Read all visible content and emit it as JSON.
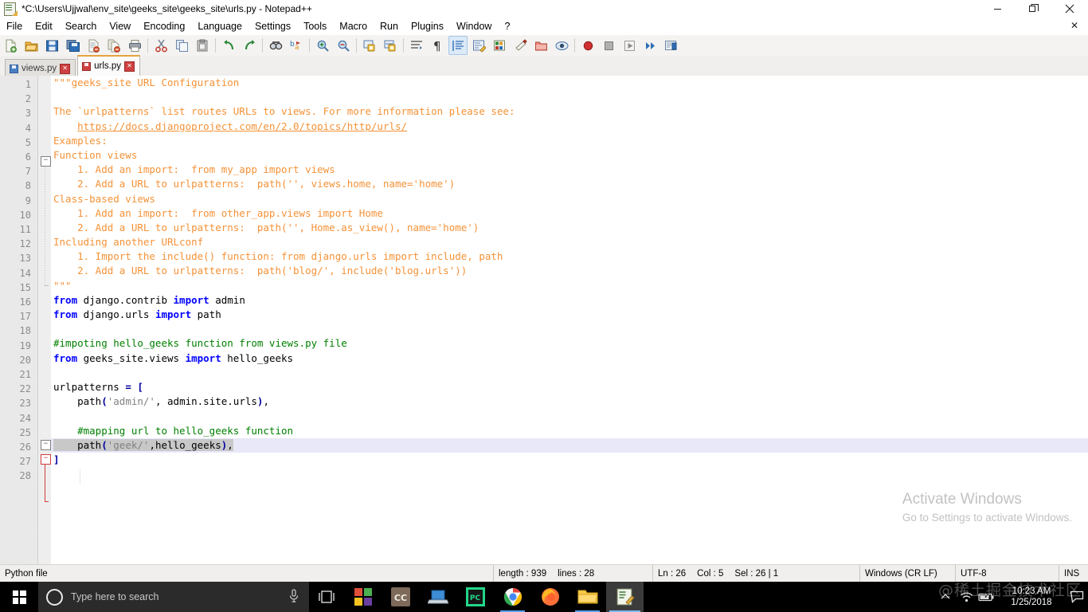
{
  "window": {
    "title": "*C:\\Users\\Ujjwal\\env_site\\geeks_site\\geeks_site\\urls.py - Notepad++",
    "app_icon": "notepad-plus-plus-icon",
    "controls": {
      "minimize": "minimize-icon",
      "restore": "restore-icon",
      "close": "close-icon"
    }
  },
  "menu": {
    "items": [
      "File",
      "Edit",
      "Search",
      "View",
      "Encoding",
      "Language",
      "Settings",
      "Tools",
      "Macro",
      "Run",
      "Plugins",
      "Window",
      "?"
    ],
    "close_document": "✕"
  },
  "toolbar": {
    "groups": [
      [
        "new-file-icon",
        "open-file-icon",
        "save-icon",
        "save-all-icon",
        "close-file-icon",
        "close-all-files-icon",
        "print-icon"
      ],
      [
        "cut-icon",
        "copy-icon",
        "paste-icon"
      ],
      [
        "undo-icon",
        "redo-icon"
      ],
      [
        "find-icon",
        "replace-icon"
      ],
      [
        "zoom-in-icon",
        "zoom-out-icon"
      ],
      [
        "sync-vertical-scroll-icon",
        "sync-horizontal-scroll-icon"
      ],
      [
        "word-wrap-icon",
        "show-all-characters-icon",
        "show-indent-guide-icon",
        "user-defined-language-icon",
        "show-function-list-icon",
        "document-map-icon",
        "folder-as-workspace-icon",
        "monitoring-icon"
      ],
      [
        "record-macro-icon",
        "stop-recording-icon",
        "playback-icon",
        "run-macro-multiple-times-icon",
        "save-current-recorded-macro-icon"
      ]
    ],
    "active_button": "show-indent-guide-icon"
  },
  "tabs": [
    {
      "label": "views.py",
      "modified": false,
      "selected": false,
      "save_icon": "save-icon-blue",
      "close": "✕"
    },
    {
      "label": "urls.py",
      "modified": true,
      "selected": true,
      "save_icon": "save-icon-red",
      "close": "✕"
    }
  ],
  "editor": {
    "current_line": 26,
    "selection_line": 26,
    "total_lines": 28,
    "lines": [
      {
        "n": 1,
        "fold": "open",
        "tokens": [
          {
            "t": "\"\"\"geeks_site URL Configuration",
            "c": "ds"
          }
        ]
      },
      {
        "n": 2,
        "tokens": []
      },
      {
        "n": 3,
        "tokens": [
          {
            "t": "The `urlpatterns` list routes URLs to views. For more information please see:",
            "c": "ds"
          }
        ]
      },
      {
        "n": 4,
        "tokens": [
          {
            "t": "    ",
            "c": "ds"
          },
          {
            "t": "https://docs.djangoproject.com/en/2.0/topics/http/urls/",
            "c": "dsu"
          }
        ]
      },
      {
        "n": 5,
        "tokens": [
          {
            "t": "Examples:",
            "c": "ds"
          }
        ]
      },
      {
        "n": 6,
        "tokens": [
          {
            "t": "Function views",
            "c": "ds"
          }
        ]
      },
      {
        "n": 7,
        "tokens": [
          {
            "t": "    1. Add an import:  from my_app import views",
            "c": "ds"
          }
        ]
      },
      {
        "n": 8,
        "tokens": [
          {
            "t": "    2. Add a URL to urlpatterns:  path('', views.home, name='home')",
            "c": "ds"
          }
        ]
      },
      {
        "n": 9,
        "tokens": [
          {
            "t": "Class-based views",
            "c": "ds"
          }
        ]
      },
      {
        "n": 10,
        "tokens": [
          {
            "t": "    1. Add an import:  from other_app.views import Home",
            "c": "ds"
          }
        ]
      },
      {
        "n": 11,
        "tokens": [
          {
            "t": "    2. Add a URL to urlpatterns:  path('', Home.as_view(), name='home')",
            "c": "ds"
          }
        ]
      },
      {
        "n": 12,
        "tokens": [
          {
            "t": "Including another URLconf",
            "c": "ds"
          }
        ]
      },
      {
        "n": 13,
        "tokens": [
          {
            "t": "    1. Import the include() function: from django.urls import include, path",
            "c": "ds"
          }
        ]
      },
      {
        "n": 14,
        "tokens": [
          {
            "t": "    2. Add a URL to urlpatterns:  path('blog/', include('blog.urls'))",
            "c": "ds"
          }
        ]
      },
      {
        "n": 15,
        "fold": "end",
        "tokens": [
          {
            "t": "\"\"\"",
            "c": "ds"
          }
        ]
      },
      {
        "n": 16,
        "tokens": [
          {
            "t": "from",
            "c": "k"
          },
          {
            "t": " django.contrib ",
            "c": "pl"
          },
          {
            "t": "import",
            "c": "k"
          },
          {
            "t": " admin",
            "c": "pl"
          }
        ]
      },
      {
        "n": 17,
        "tokens": [
          {
            "t": "from",
            "c": "k"
          },
          {
            "t": " django.urls ",
            "c": "pl"
          },
          {
            "t": "import",
            "c": "k"
          },
          {
            "t": " path",
            "c": "pl"
          }
        ]
      },
      {
        "n": 18,
        "tokens": []
      },
      {
        "n": 19,
        "tokens": [
          {
            "t": "#impoting hello_geeks function from views.py file",
            "c": "c"
          }
        ]
      },
      {
        "n": 20,
        "tokens": [
          {
            "t": "from",
            "c": "k"
          },
          {
            "t": " geeks_site.views ",
            "c": "pl"
          },
          {
            "t": "import",
            "c": "k"
          },
          {
            "t": " hello_geeks",
            "c": "pl"
          }
        ]
      },
      {
        "n": 21,
        "tokens": []
      },
      {
        "n": 22,
        "fold": "open",
        "tokens": [
          {
            "t": "urlpatterns ",
            "c": "pl"
          },
          {
            "t": "=",
            "c": "op"
          },
          {
            "t": " ",
            "c": "pl"
          },
          {
            "t": "[",
            "c": "op"
          }
        ]
      },
      {
        "n": 23,
        "fold": "open-red",
        "tokens": [
          {
            "t": "    path",
            "c": "pl"
          },
          {
            "t": "(",
            "c": "op"
          },
          {
            "t": "'admin/'",
            "c": "st"
          },
          {
            "t": ", admin.site.urls",
            "c": "pl"
          },
          {
            "t": ")",
            "c": "op"
          },
          {
            "t": ",",
            "c": "pl"
          }
        ]
      },
      {
        "n": 24,
        "tokens": []
      },
      {
        "n": 25,
        "tokens": [
          {
            "t": "    ",
            "c": "pl"
          },
          {
            "t": "#mapping url to hello_geeks function",
            "c": "c"
          }
        ]
      },
      {
        "n": 26,
        "selected_text": true,
        "tokens": [
          {
            "t": "    path",
            "c": "pl"
          },
          {
            "t": "(",
            "c": "op"
          },
          {
            "t": "'geek/'",
            "c": "st"
          },
          {
            "t": ",hello_geeks",
            "c": "pl"
          },
          {
            "t": ")",
            "c": "op"
          },
          {
            "t": ",",
            "c": "pl"
          }
        ]
      },
      {
        "n": 27,
        "tokens": [
          {
            "t": "]",
            "c": "op"
          }
        ]
      },
      {
        "n": 28,
        "tokens": []
      }
    ]
  },
  "activation_watermark": {
    "title": "Activate Windows",
    "subtitle": "Go to Settings to activate Windows."
  },
  "statusbar": {
    "file_type": "Python file",
    "length_label": "length : 939",
    "lines_label": "lines : 28",
    "ln": "Ln : 26",
    "col": "Col : 5",
    "sel": "Sel : 26 | 1",
    "eol": "Windows (CR LF)",
    "encoding": "UTF-8",
    "insert_mode": "INS"
  },
  "taskbar": {
    "start": "windows-start-icon",
    "search_placeholder": "Type here to search",
    "cortana": "cortana-circle-icon",
    "microphone": "microphone-icon",
    "task_view": "task-view-icon",
    "apps": [
      {
        "name": "microsoft-store-icon",
        "open": false,
        "focused": false
      },
      {
        "name": "creative-cloud-icon",
        "label": "CC",
        "open": false,
        "focused": false
      },
      {
        "name": "remote-desktop-icon",
        "open": false,
        "focused": false
      },
      {
        "name": "pycharm-icon",
        "label": "PC",
        "open": false,
        "focused": false
      },
      {
        "name": "google-chrome-icon",
        "open": true,
        "focused": false
      },
      {
        "name": "firefox-icon",
        "open": false,
        "focused": false
      },
      {
        "name": "file-explorer-icon",
        "open": true,
        "focused": false
      },
      {
        "name": "notepad-plus-plus-icon",
        "open": true,
        "focused": true
      }
    ],
    "tray": [
      "show-hidden-icons-chevron",
      "wifi-icon",
      "battery-icon"
    ],
    "clock_time": "10:23 AM",
    "clock_date": "1/25/2018",
    "notifications": "action-center-icon"
  },
  "overlay_watermark": "@稀土掘金技术社区"
}
